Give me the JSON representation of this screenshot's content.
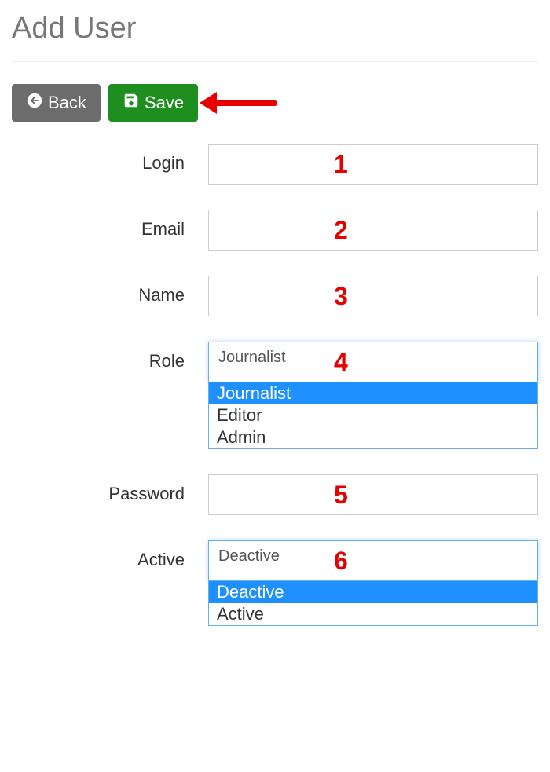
{
  "page": {
    "title": "Add User"
  },
  "toolbar": {
    "back_label": "Back",
    "save_label": "Save"
  },
  "annotations": {
    "arrow": true,
    "field_numbers": {
      "login": "1",
      "email": "2",
      "name": "3",
      "role": "4",
      "password": "5",
      "active": "6"
    }
  },
  "form": {
    "login": {
      "label": "Login",
      "value": ""
    },
    "email": {
      "label": "Email",
      "value": ""
    },
    "name": {
      "label": "Name",
      "value": ""
    },
    "role": {
      "label": "Role",
      "selected": "Journalist",
      "options": [
        "Journalist",
        "Editor",
        "Admin"
      ]
    },
    "password": {
      "label": "Password",
      "value": ""
    },
    "active": {
      "label": "Active",
      "selected": "Deactive",
      "options": [
        "Deactive",
        "Active"
      ]
    }
  }
}
